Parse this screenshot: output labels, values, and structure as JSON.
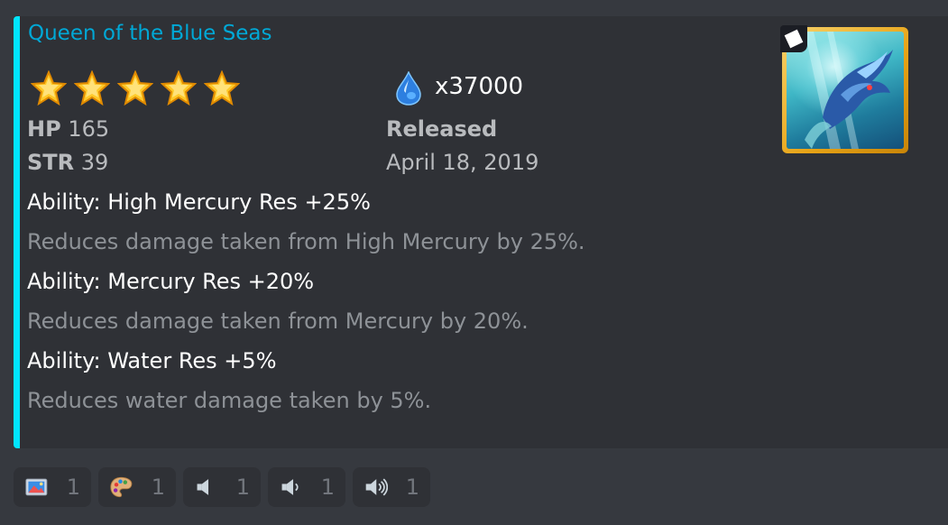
{
  "embed": {
    "accent_color": "#00e5ff",
    "title": "Queen of the Blue Seas",
    "rarity_stars": 5,
    "crystal_icon": "water-drop-icon",
    "crystal_count": "x37000",
    "hp_label": "HP",
    "hp_value": "165",
    "str_label": "STR",
    "str_value": "39",
    "released_label": "Released",
    "released_date": "April 18, 2019",
    "abilities": [
      {
        "name": "Ability: High Mercury Res +25%",
        "description": "Reduces damage taken from High Mercury by 25%."
      },
      {
        "name": "Ability: Mercury Res +20%",
        "description": "Reduces damage taken from Mercury by 20%."
      },
      {
        "name": "Ability: Water Res +5%",
        "description": "Reduces water damage taken by 5%."
      }
    ]
  },
  "reactions": [
    {
      "icon": "framed-picture-icon",
      "count": "1"
    },
    {
      "icon": "artist-palette-icon",
      "count": "1"
    },
    {
      "icon": "speaker-icon",
      "count": "1"
    },
    {
      "icon": "speaker-low-volume-icon",
      "count": "1"
    },
    {
      "icon": "speaker-high-volume-icon",
      "count": "1"
    }
  ]
}
